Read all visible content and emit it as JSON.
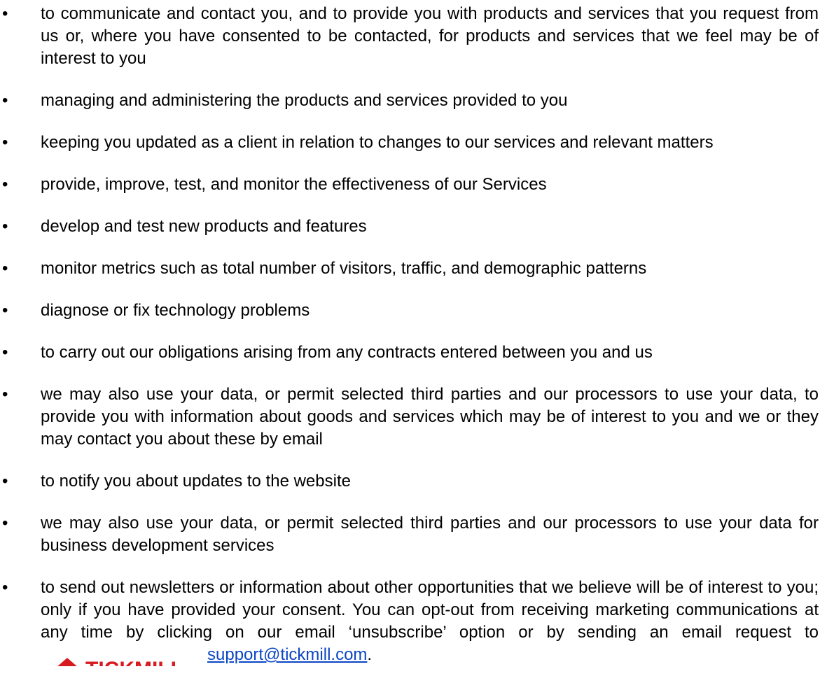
{
  "bullet_symbol": "•",
  "items": [
    "to communicate and contact you, and to provide you with products and services that you request from us or, where you have consented to be contacted, for products and services that we feel may be of interest to you",
    "managing and administering the products and services provided to you",
    "keeping you updated as a client in relation to changes to our services and relevant matters",
    "provide, improve, test, and monitor the effectiveness of our Services",
    "develop and test new products and features",
    "monitor metrics such as total number of visitors, traffic, and demographic patterns",
    "diagnose or fix technology problems",
    "to carry out our obligations arising from any contracts entered between you and us",
    "we may also use your data, or permit selected third parties and our processors to use your data, to provide you with information about goods and services which may be of interest to you and we or they may contact you about these by email",
    "to notify you about updates to the website",
    "we may also use your data, or permit selected third parties and our processors to use your data for business development services"
  ],
  "last_item": {
    "text": "to send out newsletters or information about other opportunities that we believe will be of interest to you; only if you have provided your consent. You can opt-out from receiving marketing communications at any time by clicking on our email ‘unsubscribe’ option or by sending an email request to",
    "email": "support@tickmill.com",
    "end_punct": ".",
    "logo_text": "TICKMILL",
    "logo_color": "#d71920"
  },
  "colors": {
    "link": "#0b46c4",
    "text": "#000000",
    "background": "#ffffff"
  }
}
